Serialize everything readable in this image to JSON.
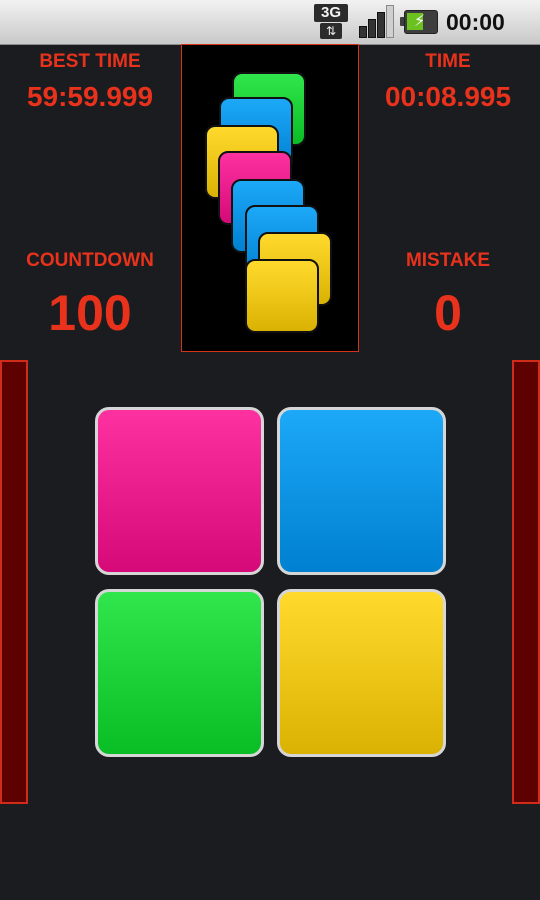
{
  "status_bar": {
    "network_type": "3G",
    "network_arrows": "⇅",
    "signal_icon": "signal-bars-icon",
    "battery_icon": "battery-charging-icon",
    "battery_level": 0.6,
    "bolt_glyph": "⚡",
    "clock": "00:00"
  },
  "stats": {
    "best_time_label": "BEST TIME",
    "best_time_value": "59:59.999",
    "time_label": "TIME",
    "time_value": "00:08.995",
    "countdown_label": "COUNTDOWN",
    "countdown_value": "100",
    "mistake_label": "MISTAKE",
    "mistake_value": "0"
  },
  "queue": {
    "cards": [
      "green",
      "blue",
      "yellow",
      "pink",
      "blue",
      "blue",
      "yellow",
      "yellow"
    ]
  },
  "tiles": [
    "pink",
    "blue",
    "green",
    "yellow"
  ],
  "colors": {
    "accent_red": "#e8321c",
    "side_bar_fill": "#5c0000",
    "background": "#1b1c20",
    "pink": "#ec1f8f",
    "blue": "#0b96e6",
    "green": "#1ed43a",
    "yellow": "#f0c81a"
  }
}
